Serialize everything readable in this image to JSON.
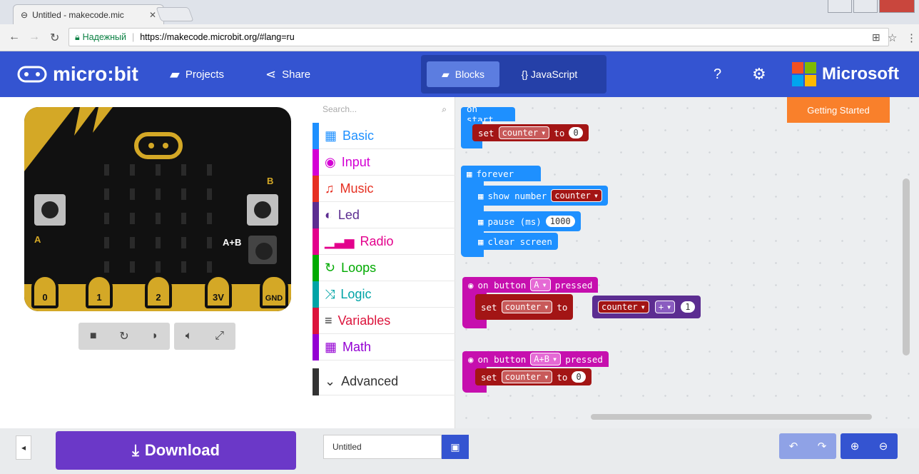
{
  "browser": {
    "tab_title": "Untitled - makecode.mic",
    "tab_close": "✕",
    "secure_label": "Надежный",
    "url": "https://makecode.microbit.org/#lang=ru"
  },
  "header": {
    "logo_text": "micro:bit",
    "projects_label": "Projects",
    "share_label": "Share",
    "blocks_label": "Blocks",
    "javascript_label": "{} JavaScript",
    "microsoft_label": "Microsoft",
    "accent_color": "#3454d1"
  },
  "simulator": {
    "pin_labels": [
      "0",
      "1",
      "2",
      "3V",
      "GND"
    ],
    "button_a": "A",
    "button_b": "B",
    "button_ab": "A+B"
  },
  "toolbox": {
    "search_placeholder": "Search...",
    "categories": [
      {
        "label": "Basic",
        "icon": "grid-icon",
        "color": "#1e90ff"
      },
      {
        "label": "Input",
        "icon": "target-icon",
        "color": "#d400d4"
      },
      {
        "label": "Music",
        "icon": "headphones-icon",
        "color": "#e63022"
      },
      {
        "label": "Led",
        "icon": "toggle-icon",
        "color": "#5c2d91"
      },
      {
        "label": "Radio",
        "icon": "signal-icon",
        "color": "#e3008c"
      },
      {
        "label": "Loops",
        "icon": "refresh-icon",
        "color": "#00aa00"
      },
      {
        "label": "Logic",
        "icon": "shuffle-icon",
        "color": "#00a4a6"
      },
      {
        "label": "Variables",
        "icon": "list-icon",
        "color": "#dc143c"
      },
      {
        "label": "Math",
        "icon": "calculator-icon",
        "color": "#9400d3"
      }
    ],
    "advanced_label": "Advanced"
  },
  "workspace": {
    "getting_started": "Getting Started",
    "on_start": {
      "title": "on start",
      "set": "set",
      "var": "counter",
      "to": "to",
      "value": "0"
    },
    "forever": {
      "title": "forever",
      "show_number": "show number",
      "var": "counter",
      "pause": "pause (ms)",
      "pause_value": "1000",
      "clear": "clear screen"
    },
    "on_button_a": {
      "prefix": "on button",
      "button": "A",
      "suffix": "pressed",
      "set": "set",
      "var": "counter",
      "to": "to",
      "var2": "counter",
      "op": "+",
      "value": "1"
    },
    "on_button_ab": {
      "prefix": "on button",
      "button": "A+B",
      "suffix": "pressed",
      "set": "set",
      "var": "counter",
      "to": "to",
      "value": "0"
    }
  },
  "bottom": {
    "download_label": "Download",
    "project_name": "Untitled"
  }
}
